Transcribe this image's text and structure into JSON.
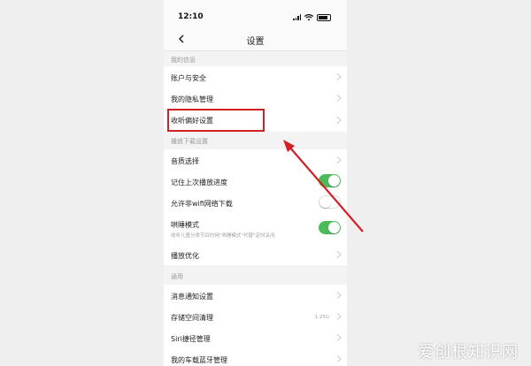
{
  "status_bar": {
    "time": "12:10"
  },
  "nav": {
    "title": "设置"
  },
  "sections": [
    {
      "header": "我的信息",
      "items": [
        {
          "label": "账户与安全"
        },
        {
          "label": "我的隐私管理"
        },
        {
          "label": "收听偏好设置"
        }
      ]
    },
    {
      "header": "播放下载设置",
      "items": [
        {
          "label": "音质选择"
        },
        {
          "label": "记住上次播放进度",
          "toggle": true
        },
        {
          "label": "允许非wifi网络下载",
          "toggle": false
        },
        {
          "label": "哄睡模式",
          "sub": "收听儿童分类节目时用\"哄睡模式\"代替\"定时关闭",
          "toggle": true
        },
        {
          "label": "播放优化"
        }
      ]
    },
    {
      "header": "通用",
      "items": [
        {
          "label": "消息通知设置"
        },
        {
          "label": "存储空间清理",
          "value": "1.25G"
        },
        {
          "label": "Siri捷径管理"
        },
        {
          "label": "我的车载蓝牙管理"
        }
      ]
    }
  ],
  "colors": {
    "accent_red": "#d32027",
    "toggle_green": "#4cbb5a"
  },
  "watermark": "爱创根知识网"
}
